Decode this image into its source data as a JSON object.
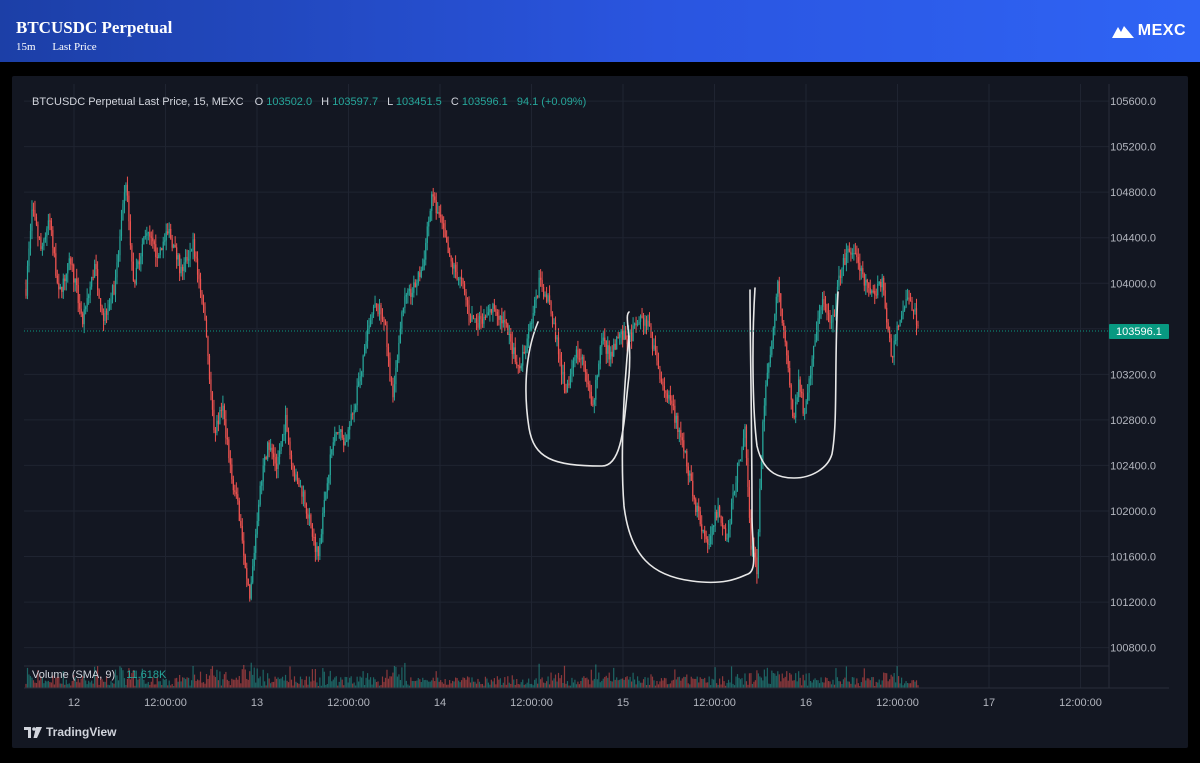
{
  "header": {
    "title": "BTCUSDC Perpetual",
    "interval": "15m",
    "price_type": "Last Price",
    "brand": "MEXC"
  },
  "legend": {
    "symbol": "BTCUSDC Perpetual Last Price, 15, MEXC",
    "o_label": "O",
    "o_value": "103502.0",
    "h_label": "H",
    "h_value": "103597.7",
    "l_label": "L",
    "l_value": "103451.5",
    "c_label": "C",
    "c_value": "103596.1",
    "change": "94.1 (+0.09%)"
  },
  "volume_legend": {
    "label": "Volume (SMA, 9)",
    "value": "11.618K"
  },
  "current_price_label": "103596.1",
  "footer": {
    "brand": "TradingView"
  },
  "colors": {
    "up": "#26a69a",
    "down": "#ef5350",
    "price_tag": "#089981",
    "background": "#131722",
    "grid": "#1f2431",
    "axis_text": "#b2b5be"
  },
  "chart_data": {
    "type": "candlestick",
    "interval": "15m",
    "ylim": [
      100700,
      105750
    ],
    "y_ticks": [
      "105600.0",
      "105200.0",
      "104800.0",
      "104400.0",
      "104000.0",
      "103600.0",
      "103200.0",
      "102800.0",
      "102400.0",
      "102000.0",
      "101600.0",
      "101200.0",
      "100800.0"
    ],
    "x_ticks": [
      "12",
      "12:00:00",
      "13",
      "12:00:00",
      "14",
      "12:00:00",
      "15",
      "12:00:00",
      "16",
      "12:00:00",
      "17",
      "12:00:00"
    ],
    "last_price": 103596.1,
    "price_path": [
      [
        0,
        103950
      ],
      [
        4,
        104650
      ],
      [
        10,
        104300
      ],
      [
        16,
        104550
      ],
      [
        22,
        103900
      ],
      [
        30,
        104200
      ],
      [
        38,
        103650
      ],
      [
        46,
        104150
      ],
      [
        52,
        103700
      ],
      [
        60,
        104000
      ],
      [
        67,
        104900
      ],
      [
        72,
        104000
      ],
      [
        80,
        104450
      ],
      [
        88,
        104250
      ],
      [
        96,
        104450
      ],
      [
        104,
        104100
      ],
      [
        112,
        104350
      ],
      [
        120,
        103700
      ],
      [
        126,
        102700
      ],
      [
        132,
        102900
      ],
      [
        138,
        102300
      ],
      [
        144,
        101900
      ],
      [
        150,
        101200
      ],
      [
        156,
        102100
      ],
      [
        162,
        102600
      ],
      [
        168,
        102400
      ],
      [
        174,
        102800
      ],
      [
        180,
        102300
      ],
      [
        186,
        102150
      ],
      [
        192,
        101800
      ],
      [
        196,
        101600
      ],
      [
        202,
        102300
      ],
      [
        208,
        102750
      ],
      [
        214,
        102600
      ],
      [
        220,
        102900
      ],
      [
        228,
        103500
      ],
      [
        234,
        103800
      ],
      [
        240,
        103700
      ],
      [
        246,
        102950
      ],
      [
        252,
        103800
      ],
      [
        260,
        103950
      ],
      [
        266,
        104150
      ],
      [
        272,
        104750
      ],
      [
        278,
        104550
      ],
      [
        284,
        104200
      ],
      [
        292,
        104000
      ],
      [
        298,
        103700
      ],
      [
        306,
        103650
      ],
      [
        314,
        103800
      ],
      [
        322,
        103600
      ],
      [
        330,
        103250
      ],
      [
        336,
        103500
      ],
      [
        344,
        104000
      ],
      [
        350,
        103850
      ],
      [
        356,
        103500
      ],
      [
        362,
        103000
      ],
      [
        368,
        103400
      ],
      [
        374,
        103300
      ],
      [
        380,
        102900
      ],
      [
        386,
        103500
      ],
      [
        392,
        103350
      ],
      [
        398,
        103550
      ],
      [
        404,
        103500
      ],
      [
        412,
        103700
      ],
      [
        418,
        103600
      ],
      [
        424,
        103250
      ],
      [
        430,
        103000
      ],
      [
        436,
        102800
      ],
      [
        442,
        102500
      ],
      [
        448,
        102100
      ],
      [
        452,
        101900
      ],
      [
        458,
        101700
      ],
      [
        464,
        102050
      ],
      [
        470,
        101750
      ],
      [
        476,
        102300
      ],
      [
        482,
        102700
      ],
      [
        486,
        101700
      ],
      [
        490,
        101500
      ],
      [
        494,
        102800
      ],
      [
        498,
        103300
      ],
      [
        504,
        104000
      ],
      [
        510,
        103400
      ],
      [
        514,
        102800
      ],
      [
        518,
        103100
      ],
      [
        522,
        102850
      ],
      [
        528,
        103450
      ],
      [
        534,
        103900
      ],
      [
        540,
        103600
      ],
      [
        546,
        104100
      ],
      [
        552,
        104300
      ],
      [
        556,
        104250
      ],
      [
        562,
        104000
      ],
      [
        568,
        103900
      ],
      [
        574,
        104050
      ],
      [
        580,
        103350
      ],
      [
        586,
        103700
      ],
      [
        592,
        103900
      ],
      [
        598,
        103650
      ]
    ],
    "volume": {
      "name": "Volume (SMA, 9)",
      "last": "11.618K"
    }
  }
}
